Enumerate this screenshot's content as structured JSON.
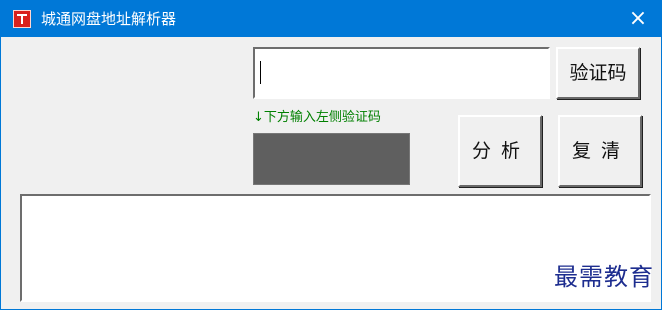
{
  "window": {
    "title": "城通网盘地址解析器",
    "close_glyph": "×",
    "accent": "#0078d7"
  },
  "form": {
    "captcha_value": "",
    "hint": "↓下方输入左侧验证码",
    "verify_label": "验证码",
    "analyze_label": "分析",
    "clear_label": "复清"
  },
  "output": {
    "text": ""
  },
  "watermark": "最需教育"
}
